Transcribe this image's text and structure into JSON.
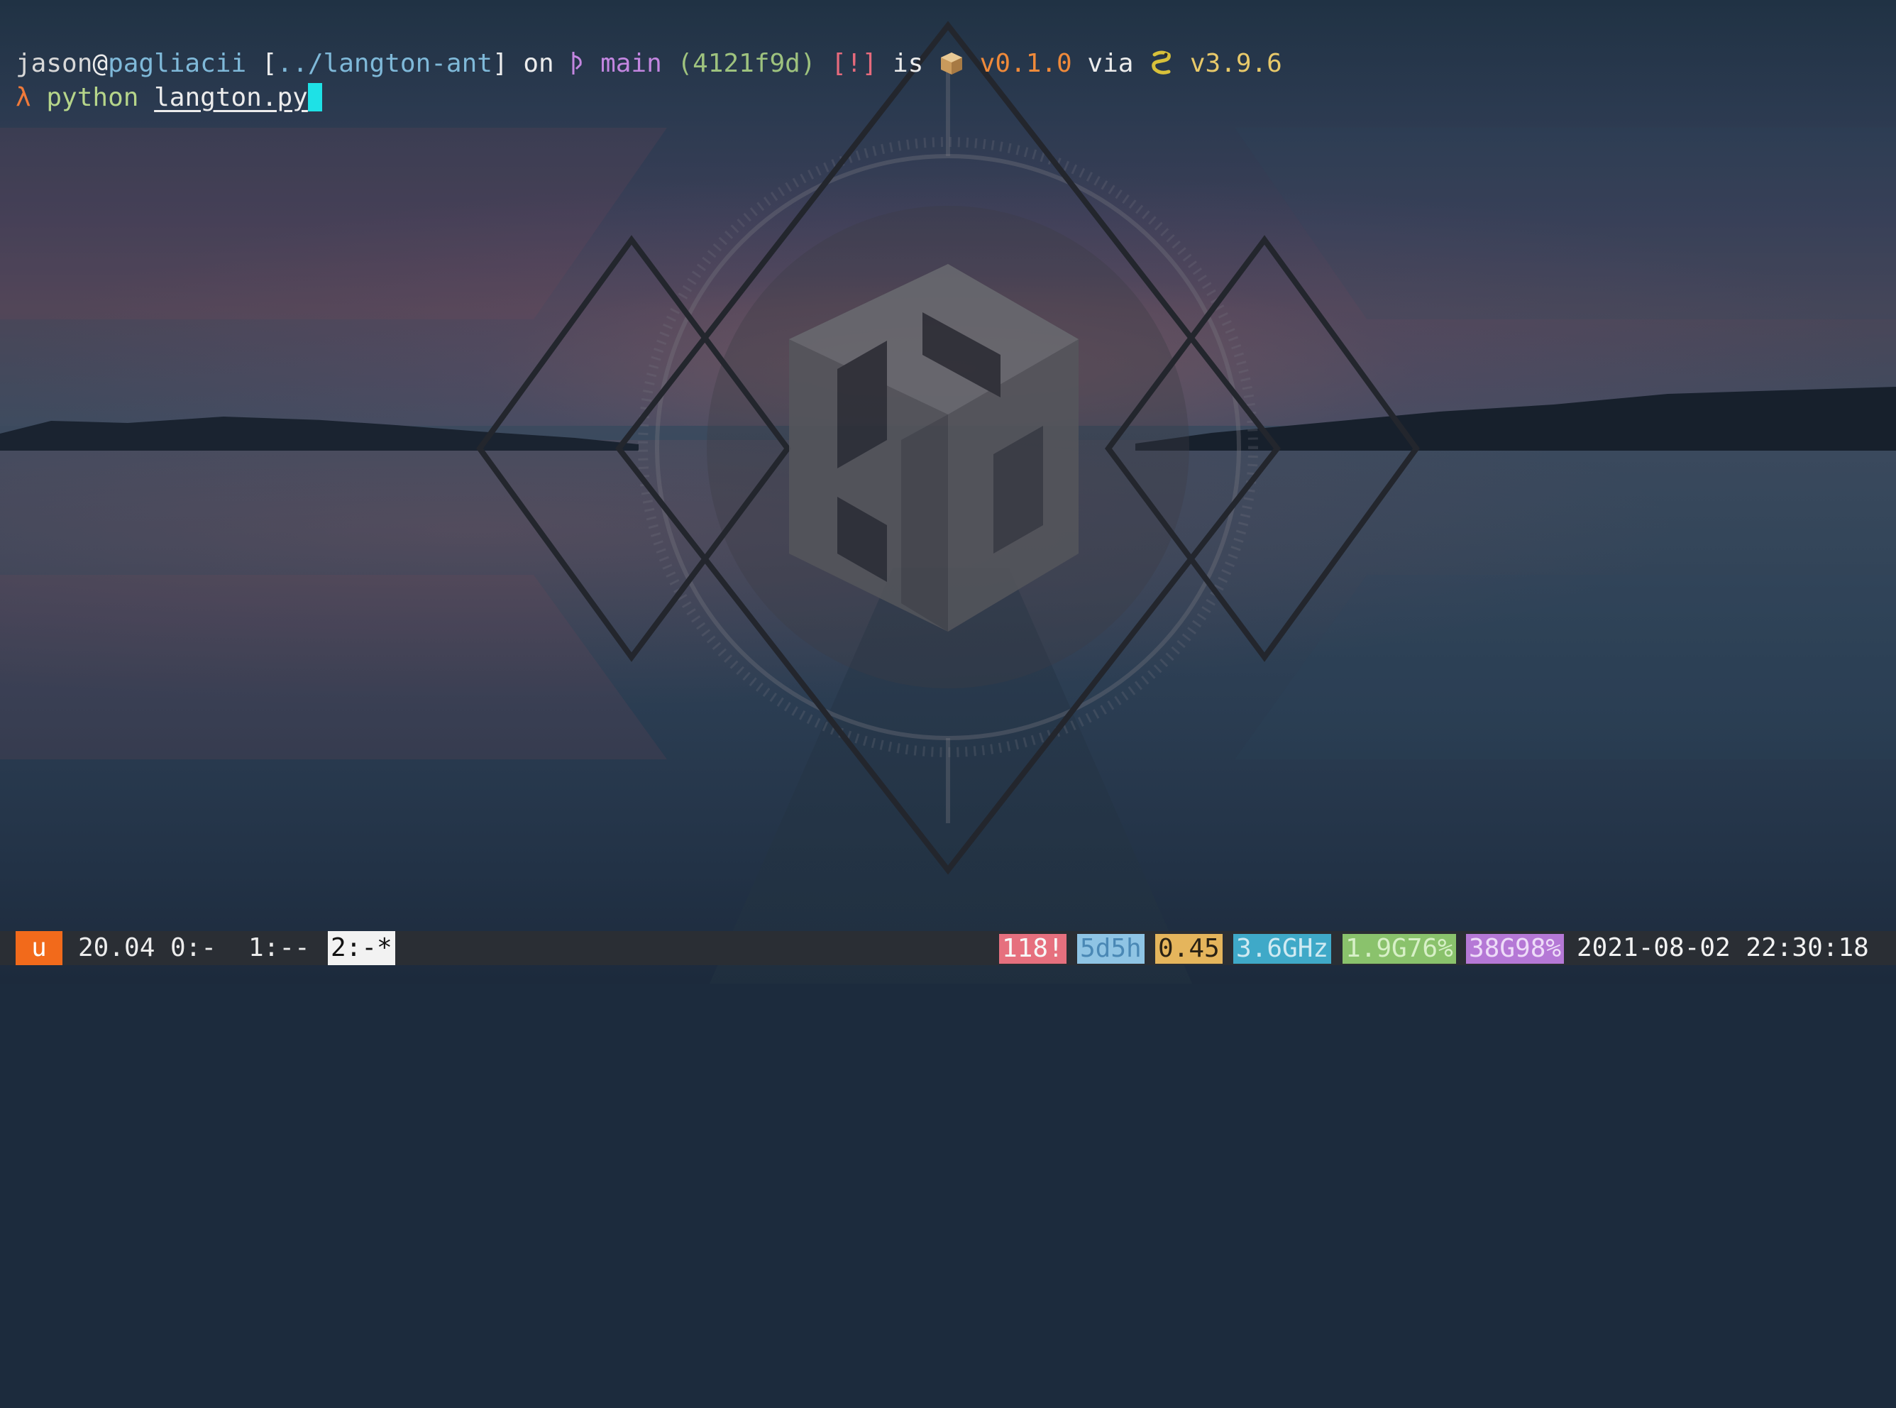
{
  "prompt": {
    "user": "jason",
    "at": "@",
    "host": "pagliacii",
    "path_open": "[",
    "path": "../langton-ant",
    "path_close": "]",
    "on": "on",
    "branch": "main",
    "commit": "(4121f9d)",
    "status": "[!]",
    "is": "is",
    "package_version": "v0.1.0",
    "via": "via",
    "python_version": "v3.9.6"
  },
  "command": {
    "symbol": "λ",
    "program": "python",
    "argument": "langton.py"
  },
  "statusbar": {
    "session": "u",
    "os_version": "20.04",
    "windows": [
      "0:-",
      "1:--",
      "2:-*"
    ],
    "processes": "118!",
    "uptime": "5d5h",
    "load": "0.45",
    "cpu_freq": "3.6GHz",
    "memory": "1.9G76%",
    "disk": "38G98%",
    "datetime": "2021-08-02 22:30:18"
  },
  "colors": {
    "cursor": "#1ee1e6",
    "session_badge": "#f26a1b",
    "branch": "#c386e0",
    "version": "#f08a3a"
  },
  "icons": {
    "git_branch": "git-branch-icon",
    "package": "package-icon",
    "python": "python-icon"
  }
}
